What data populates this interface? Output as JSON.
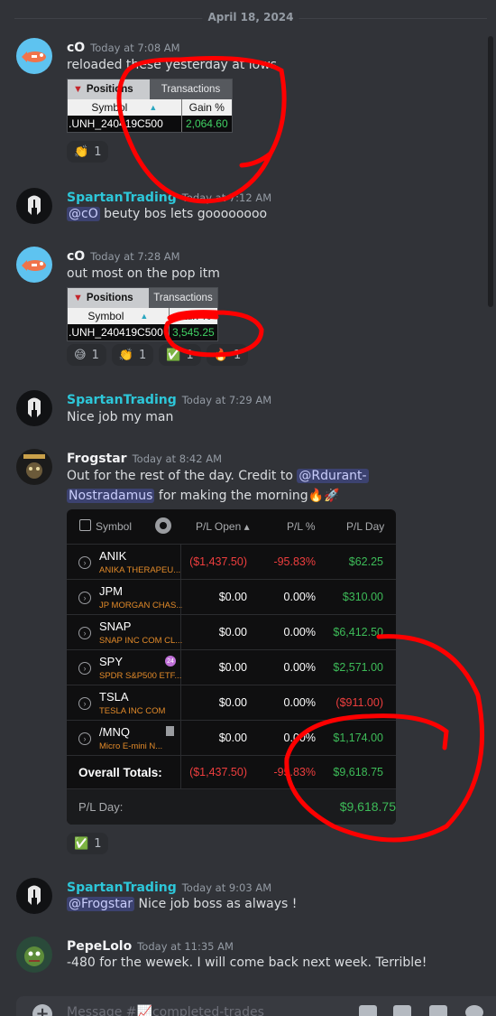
{
  "date_divider": "April 18, 2024",
  "messages": [
    {
      "author": "cO",
      "timestamp": "Today at 7:08 AM",
      "text": "reloaded these yesterday at lows",
      "widget": {
        "tab_positions": "Positions",
        "tab_transactions": "Transactions",
        "col_symbol": "Symbol",
        "col_gain": "Gain %",
        "symbol": ".UNH_240419C500",
        "gain": "2,064.60"
      },
      "reactions": [
        {
          "emoji": "👏",
          "count": "1"
        }
      ]
    },
    {
      "author": "SpartanTrading",
      "timestamp": "Today at 7:12 AM",
      "mention": "@cO",
      "text": " beuty bos lets goooooooo"
    },
    {
      "author": "cO",
      "timestamp": "Today at 7:28 AM",
      "text": "out most on the pop itm",
      "widget": {
        "tab_positions": "Positions",
        "tab_transactions": "Transactions",
        "col_symbol": "Symbol",
        "col_gain": "Gain %",
        "symbol": ".UNH_240419C500",
        "gain": "3,545.25"
      },
      "reactions": [
        {
          "emoji": "😅",
          "count": "1"
        },
        {
          "emoji": "👏",
          "count": "1"
        },
        {
          "emoji": "✅",
          "count": "1"
        },
        {
          "emoji": "🔥",
          "count": "1"
        }
      ]
    },
    {
      "author": "SpartanTrading",
      "timestamp": "Today at 7:29 AM",
      "text": "Nice job my man"
    },
    {
      "author": "Frogstar",
      "timestamp": "Today at 8:42 AM",
      "text_line1": "Out for the rest of the day.  Credit to ",
      "mention_part1": "@Rdurant-",
      "mention_part2": "Nostradamus",
      "text_line2": " for making the morning🔥🚀",
      "reactions": [
        {
          "emoji": "✅",
          "count": "1"
        }
      ]
    },
    {
      "author": "SpartanTrading",
      "timestamp": "Today at 9:03 AM",
      "mention": "@Frogstar",
      "text": " Nice job boss as always !"
    },
    {
      "author": "PepeLolo",
      "timestamp": "Today at 11:35 AM",
      "text": "-480 for the wewek. I will come back next week. Terrible!"
    }
  ],
  "panel": {
    "headers": {
      "symbol": "Symbol",
      "pl_open": "P/L Open ▴",
      "pl_pct": "P/L %",
      "pl_day": "P/L Day"
    },
    "rows": [
      {
        "symbol": "ANIK",
        "desc": "ANIKA THERAPEU...",
        "pl_open": "($1,437.50)",
        "pl_pct": "-95.83%",
        "pl_day": "$62.25",
        "open_color": "red",
        "pct_color": "red",
        "day_color": "grn"
      },
      {
        "symbol": "JPM",
        "desc": "JP MORGAN CHAS...",
        "pl_open": "$0.00",
        "pl_pct": "0.00%",
        "pl_day": "$310.00",
        "open_color": "white",
        "pct_color": "white",
        "day_color": "grn"
      },
      {
        "symbol": "SNAP",
        "desc": "SNAP INC COM CL...",
        "pl_open": "$0.00",
        "pl_pct": "0.00%",
        "pl_day": "$6,412.50",
        "open_color": "white",
        "pct_color": "white",
        "day_color": "grn"
      },
      {
        "symbol": "SPY",
        "desc": "SPDR S&P500 ETF...",
        "pl_open": "$0.00",
        "pl_pct": "0.00%",
        "pl_day": "$2,571.00",
        "open_color": "white",
        "pct_color": "white",
        "day_color": "grn",
        "badge": "24"
      },
      {
        "symbol": "TSLA",
        "desc": "TESLA INC COM",
        "pl_open": "$0.00",
        "pl_pct": "0.00%",
        "pl_day": "($911.00)",
        "open_color": "white",
        "pct_color": "white",
        "day_color": "red"
      },
      {
        "symbol": "/MNQ",
        "desc": "Micro E-mini N...",
        "pl_open": "$0.00",
        "pl_pct": "0.00%",
        "pl_day": "$1,174.00",
        "open_color": "white",
        "pct_color": "white",
        "day_color": "grn"
      }
    ],
    "totals_label": "Overall Totals:",
    "totals_open": "($1,437.50)",
    "totals_pct": "-95.83%",
    "totals_day": "$9,618.75",
    "plday_label": "P/L Day:",
    "plday_value": "$9,618.75"
  },
  "composer": {
    "placeholder": "Message #📈completed-trades"
  },
  "colors": {
    "background": "#313338",
    "mention_bg": "#3c4270",
    "username_cyan": "#2dc7d9",
    "annotation_red": "#ff0000"
  }
}
